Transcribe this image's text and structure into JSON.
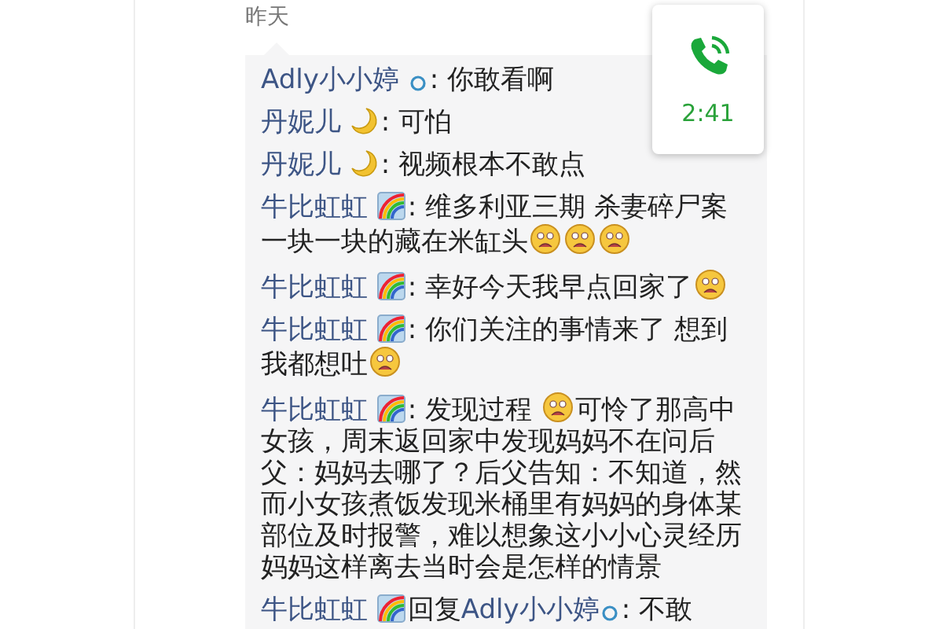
{
  "date_label": "昨天",
  "call_card": {
    "duration": "2:41"
  },
  "comments": [
    {
      "name": "Adly小小婷",
      "badge": {
        "kind": "circle"
      },
      "parts": [
        {
          "kind": "text",
          "text": ": 你敢看啊"
        }
      ]
    },
    {
      "name": "丹妮儿",
      "badge": {
        "kind": "moon"
      },
      "parts": [
        {
          "kind": "text",
          "text": ": 可怕"
        }
      ]
    },
    {
      "name": "丹妮儿",
      "badge": {
        "kind": "moon"
      },
      "parts": [
        {
          "kind": "text",
          "text": ": 视频根本不敢点"
        }
      ]
    },
    {
      "name": "牛比虹虹",
      "badge": {
        "kind": "rainbow"
      },
      "parts": [
        {
          "kind": "text",
          "text": ": 维多利亚三期 杀妻碎尸案一块一块的藏在米缸头"
        },
        {
          "kind": "emoji"
        },
        {
          "kind": "emoji"
        },
        {
          "kind": "emoji"
        }
      ]
    },
    {
      "name": "牛比虹虹",
      "badge": {
        "kind": "rainbow"
      },
      "parts": [
        {
          "kind": "text",
          "text": ": 幸好今天我早点回家了"
        },
        {
          "kind": "emoji"
        }
      ]
    },
    {
      "name": "牛比虹虹",
      "badge": {
        "kind": "rainbow"
      },
      "parts": [
        {
          "kind": "text",
          "text": ": 你们关注的事情来了 想到我都想吐"
        },
        {
          "kind": "emoji"
        }
      ]
    },
    {
      "name": "牛比虹虹",
      "badge": {
        "kind": "rainbow"
      },
      "parts": [
        {
          "kind": "text",
          "text": ": 发现过程 "
        },
        {
          "kind": "emoji"
        },
        {
          "kind": "text",
          "text": "可怜了那高中女孩，周末返回家中发现妈妈不在问后父：妈妈去哪了？后父告知：不知道，然而小女孩煮饭发现米桶里有妈妈的身体某部位及时报警，难以想象这小小心灵经历妈妈这样离去当时会是怎样的情景"
        }
      ]
    },
    {
      "name": "牛比虹虹",
      "badge": {
        "kind": "rainbow"
      },
      "reply_label": "回复",
      "reply_to": "Adly小小婷",
      "reply_badge": {
        "kind": "circle"
      },
      "parts": [
        {
          "kind": "text",
          "text": ": 不敢"
        }
      ]
    }
  ]
}
